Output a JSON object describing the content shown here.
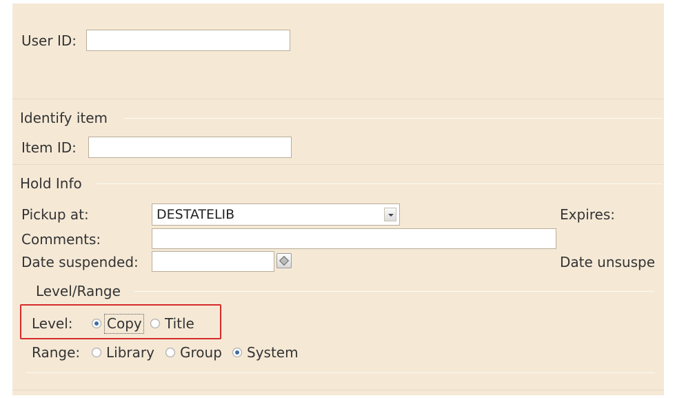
{
  "user": {
    "label": "User ID:",
    "value": ""
  },
  "identify_item": {
    "legend": "Identify item",
    "item_id_label": "Item ID:",
    "item_id_value": ""
  },
  "hold_info": {
    "legend": "Hold Info",
    "pickup_label": "Pickup at:",
    "pickup_value": "DESTATELIB",
    "expires_label": "Expires:",
    "comments_label": "Comments:",
    "comments_value": "",
    "date_suspended_label": "Date suspended:",
    "date_suspended_value": "",
    "date_unsuspend_label": "Date unsuspe"
  },
  "level_range": {
    "legend": "Level/Range",
    "level_label": "Level:",
    "level_options": [
      {
        "label": "Copy",
        "selected": true
      },
      {
        "label": "Title",
        "selected": false
      }
    ],
    "range_label": "Range:",
    "range_options": [
      {
        "label": "Library",
        "selected": false
      },
      {
        "label": "Group",
        "selected": false
      },
      {
        "label": "System",
        "selected": true
      }
    ]
  },
  "colors": {
    "panel": "#f5e9d6",
    "highlight": "#d62a2a",
    "radio_selected": "#3b6ea5"
  },
  "icons": {
    "date_picker": "calendar-icon",
    "dropdown": "chevron-down-icon"
  }
}
